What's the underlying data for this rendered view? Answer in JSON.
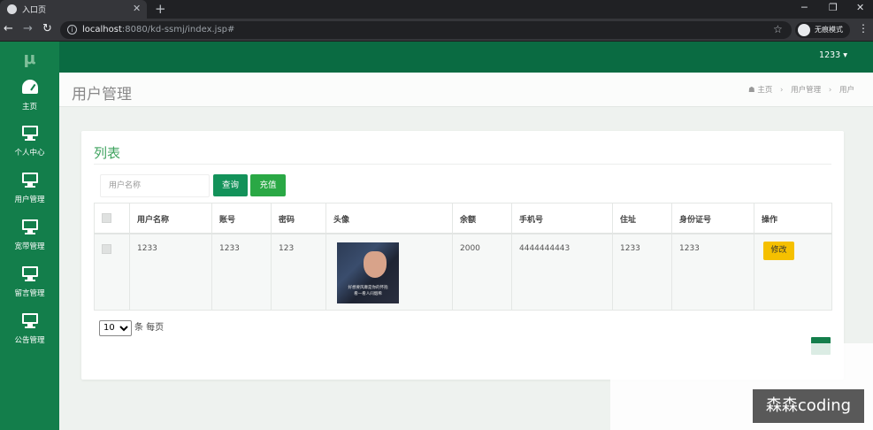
{
  "browser": {
    "tab_title": "入口页",
    "url_host": "localhost",
    "url_rest": ":8080/kd-ssmj/index.jsp#",
    "incognito_label": "无痕模式"
  },
  "sidebar": {
    "logo": "μ",
    "items": [
      {
        "label": "主页",
        "icon": "dashboard-icon"
      },
      {
        "label": "个人中心",
        "icon": "monitor-icon"
      },
      {
        "label": "用户管理",
        "icon": "monitor-icon"
      },
      {
        "label": "宽带管理",
        "icon": "monitor-icon"
      },
      {
        "label": "留言管理",
        "icon": "monitor-icon"
      },
      {
        "label": "公告管理",
        "icon": "monitor-icon"
      }
    ]
  },
  "header": {
    "user": "1233 ▾"
  },
  "page": {
    "title": "用户管理",
    "breadcrumb": [
      "主页",
      "用户管理",
      "用户"
    ]
  },
  "card": {
    "title": "列表",
    "search_placeholder": "用户名称",
    "query_label": "查询",
    "recharge_label": "充值"
  },
  "table": {
    "headers": [
      "用户名称",
      "账号",
      "密码",
      "头像",
      "余额",
      "手机号",
      "住址",
      "身份证号",
      "操作"
    ],
    "rows": [
      {
        "username": "1233",
        "account": "1233",
        "password": "123",
        "avatar_caption": "好想要风靡是你的怀抱\n看一看人间烟稀",
        "balance": "2000",
        "phone": "4444444443",
        "address": "1233",
        "id_card": "1233",
        "action_label": "修改"
      }
    ]
  },
  "pagination": {
    "page_size": "10",
    "suffix": "条 每页"
  },
  "watermark": "森森coding",
  "colors": {
    "sidebar": "#137e4b",
    "topbar": "#0a6b42",
    "accent": "#3fa35f",
    "edit_button": "#f5c000"
  }
}
